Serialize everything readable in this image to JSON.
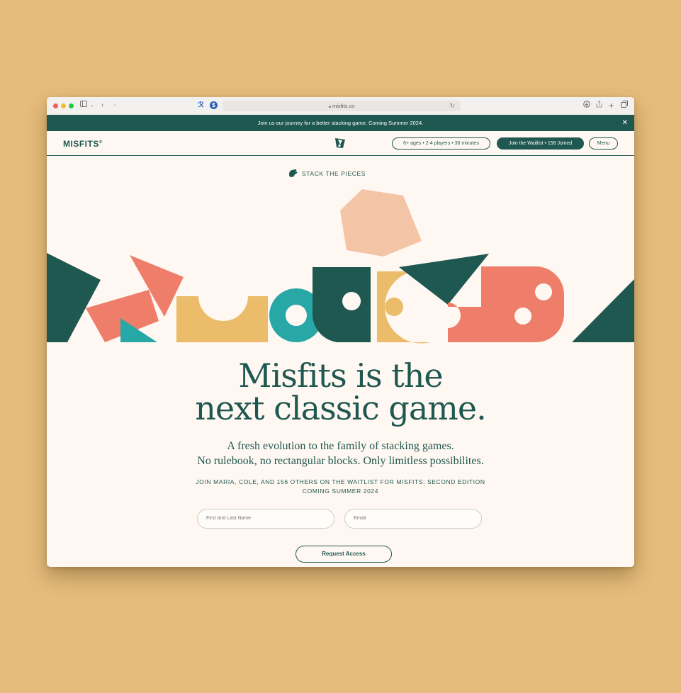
{
  "browser": {
    "url": "misfits.co",
    "icons": [
      "sidebar-icon",
      "chevron-down-icon",
      "back-icon",
      "forward-icon",
      "download-icon",
      "share-icon",
      "new-tab-icon",
      "tabs-overview-icon",
      "reload-icon",
      "lock-icon"
    ]
  },
  "announcement": {
    "text": "Join us our journey for a better stacking game. Coming Summer 2024.",
    "close": "✕"
  },
  "header": {
    "logo": "MISFITS",
    "logo_mark": "®",
    "info_pill": "6+ ages • 2-4 players • 30 minutes",
    "waitlist_button": "Join the Waitlist • 158 Joined",
    "menu_button": "Menu"
  },
  "hero": {
    "eyebrow": "STACK THE PIECES",
    "headline_line1": "Misfits is the",
    "headline_line2": "next classic game.",
    "sub_line1": "A fresh evolution to the family of stacking games.",
    "sub_line2": "No rulebook, no rectangular blocks. Only limitless possibilites.",
    "waitlist_line1": "JOIN MARIA, COLE, AND 156 OTHERS ON THE WAITLIST FOR MISFITS: SECOND EDITION",
    "waitlist_line2": "COMING SUMMER 2024"
  },
  "form": {
    "name_placeholder": "First and Last Name",
    "email_placeholder": "Email",
    "submit_label": "Request Access"
  },
  "colors": {
    "background": "#e6bc7c",
    "page": "#fff8f2",
    "brand_green": "#1f5850",
    "coral": "#ee7e69",
    "mustard": "#ebbd6b",
    "teal": "#27a7a6",
    "peach": "#f4c4a6"
  }
}
